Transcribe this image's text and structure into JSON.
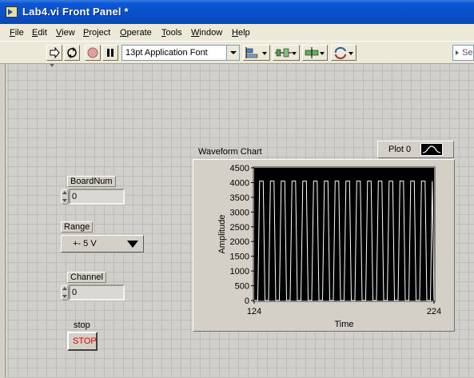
{
  "window": {
    "title": "Lab4.vi Front Panel *"
  },
  "menu": [
    {
      "label": "File",
      "u": "F",
      "rest": "ile"
    },
    {
      "label": "Edit",
      "u": "E",
      "rest": "dit"
    },
    {
      "label": "View",
      "u": "V",
      "rest": "iew"
    },
    {
      "label": "Project",
      "u": "P",
      "rest": "roject"
    },
    {
      "label": "Operate",
      "u": "O",
      "rest": "perate"
    },
    {
      "label": "Tools",
      "u": "T",
      "rest": "ools"
    },
    {
      "label": "Window",
      "u": "W",
      "rest": "indow"
    },
    {
      "label": "Help",
      "u": "H",
      "rest": "elp"
    }
  ],
  "toolbar": {
    "buttons": [
      "run-icon",
      "run-continuously-icon",
      "abort-icon",
      "pause-icon"
    ],
    "font": "13pt Application Font",
    "dropdowns": [
      "align-objects-icon",
      "distribute-objects-icon",
      "resize-objects-icon",
      "reorder-icon"
    ],
    "search_text": "Se"
  },
  "controls": {
    "boardnum": {
      "label": "BoardNum",
      "value": "0"
    },
    "range": {
      "label": "Range",
      "value": "+- 5 V"
    },
    "channel": {
      "label": "Channel",
      "value": "0"
    },
    "stop": {
      "label": "stop",
      "button_text": "STOP",
      "text_color": "#e00000"
    }
  },
  "legend": {
    "plot_name": "Plot 0"
  },
  "chart_data": {
    "type": "line",
    "title": "Waveform Chart",
    "xlabel": "Time",
    "ylabel": "Amplitude",
    "xlim": [
      124,
      224
    ],
    "ylim": [
      0,
      4500
    ],
    "x_ticks": [
      "124",
      "224"
    ],
    "y_ticks": [
      "0",
      "500",
      "1000",
      "1500",
      "2000",
      "2500",
      "3000",
      "3500",
      "4000",
      "4500"
    ],
    "plot_background": "#000000",
    "line_color": "#ffffff",
    "series": [
      {
        "name": "Plot 0",
        "x": [
          124,
          126,
          127,
          129,
          130,
          132,
          133,
          135,
          136,
          138,
          139,
          141,
          142,
          144,
          145,
          147,
          148,
          150,
          151,
          153,
          154,
          156,
          157,
          159,
          160,
          162,
          163,
          165,
          166,
          168,
          169,
          171,
          172,
          174,
          175,
          177,
          178,
          180,
          181,
          183,
          184,
          186,
          187,
          189,
          190,
          192,
          193,
          195,
          196,
          198,
          199,
          201,
          202,
          204,
          205,
          207,
          208,
          210,
          211,
          213,
          214,
          216,
          217,
          219,
          220,
          222,
          223,
          224
        ],
        "y": [
          0,
          0,
          4050,
          4050,
          0,
          0,
          4050,
          4050,
          0,
          0,
          4050,
          4050,
          0,
          0,
          4050,
          4050,
          0,
          0,
          4050,
          4050,
          0,
          0,
          4050,
          4050,
          0,
          0,
          4050,
          4050,
          0,
          0,
          4050,
          4050,
          0,
          0,
          4050,
          4050,
          0,
          0,
          4050,
          4050,
          0,
          0,
          4050,
          4050,
          0,
          0,
          4050,
          4050,
          0,
          0,
          4050,
          4050,
          0,
          0,
          4050,
          4050,
          0,
          0,
          4050,
          4050,
          0,
          0,
          4050,
          4050,
          0,
          0,
          4050,
          0
        ]
      }
    ]
  }
}
